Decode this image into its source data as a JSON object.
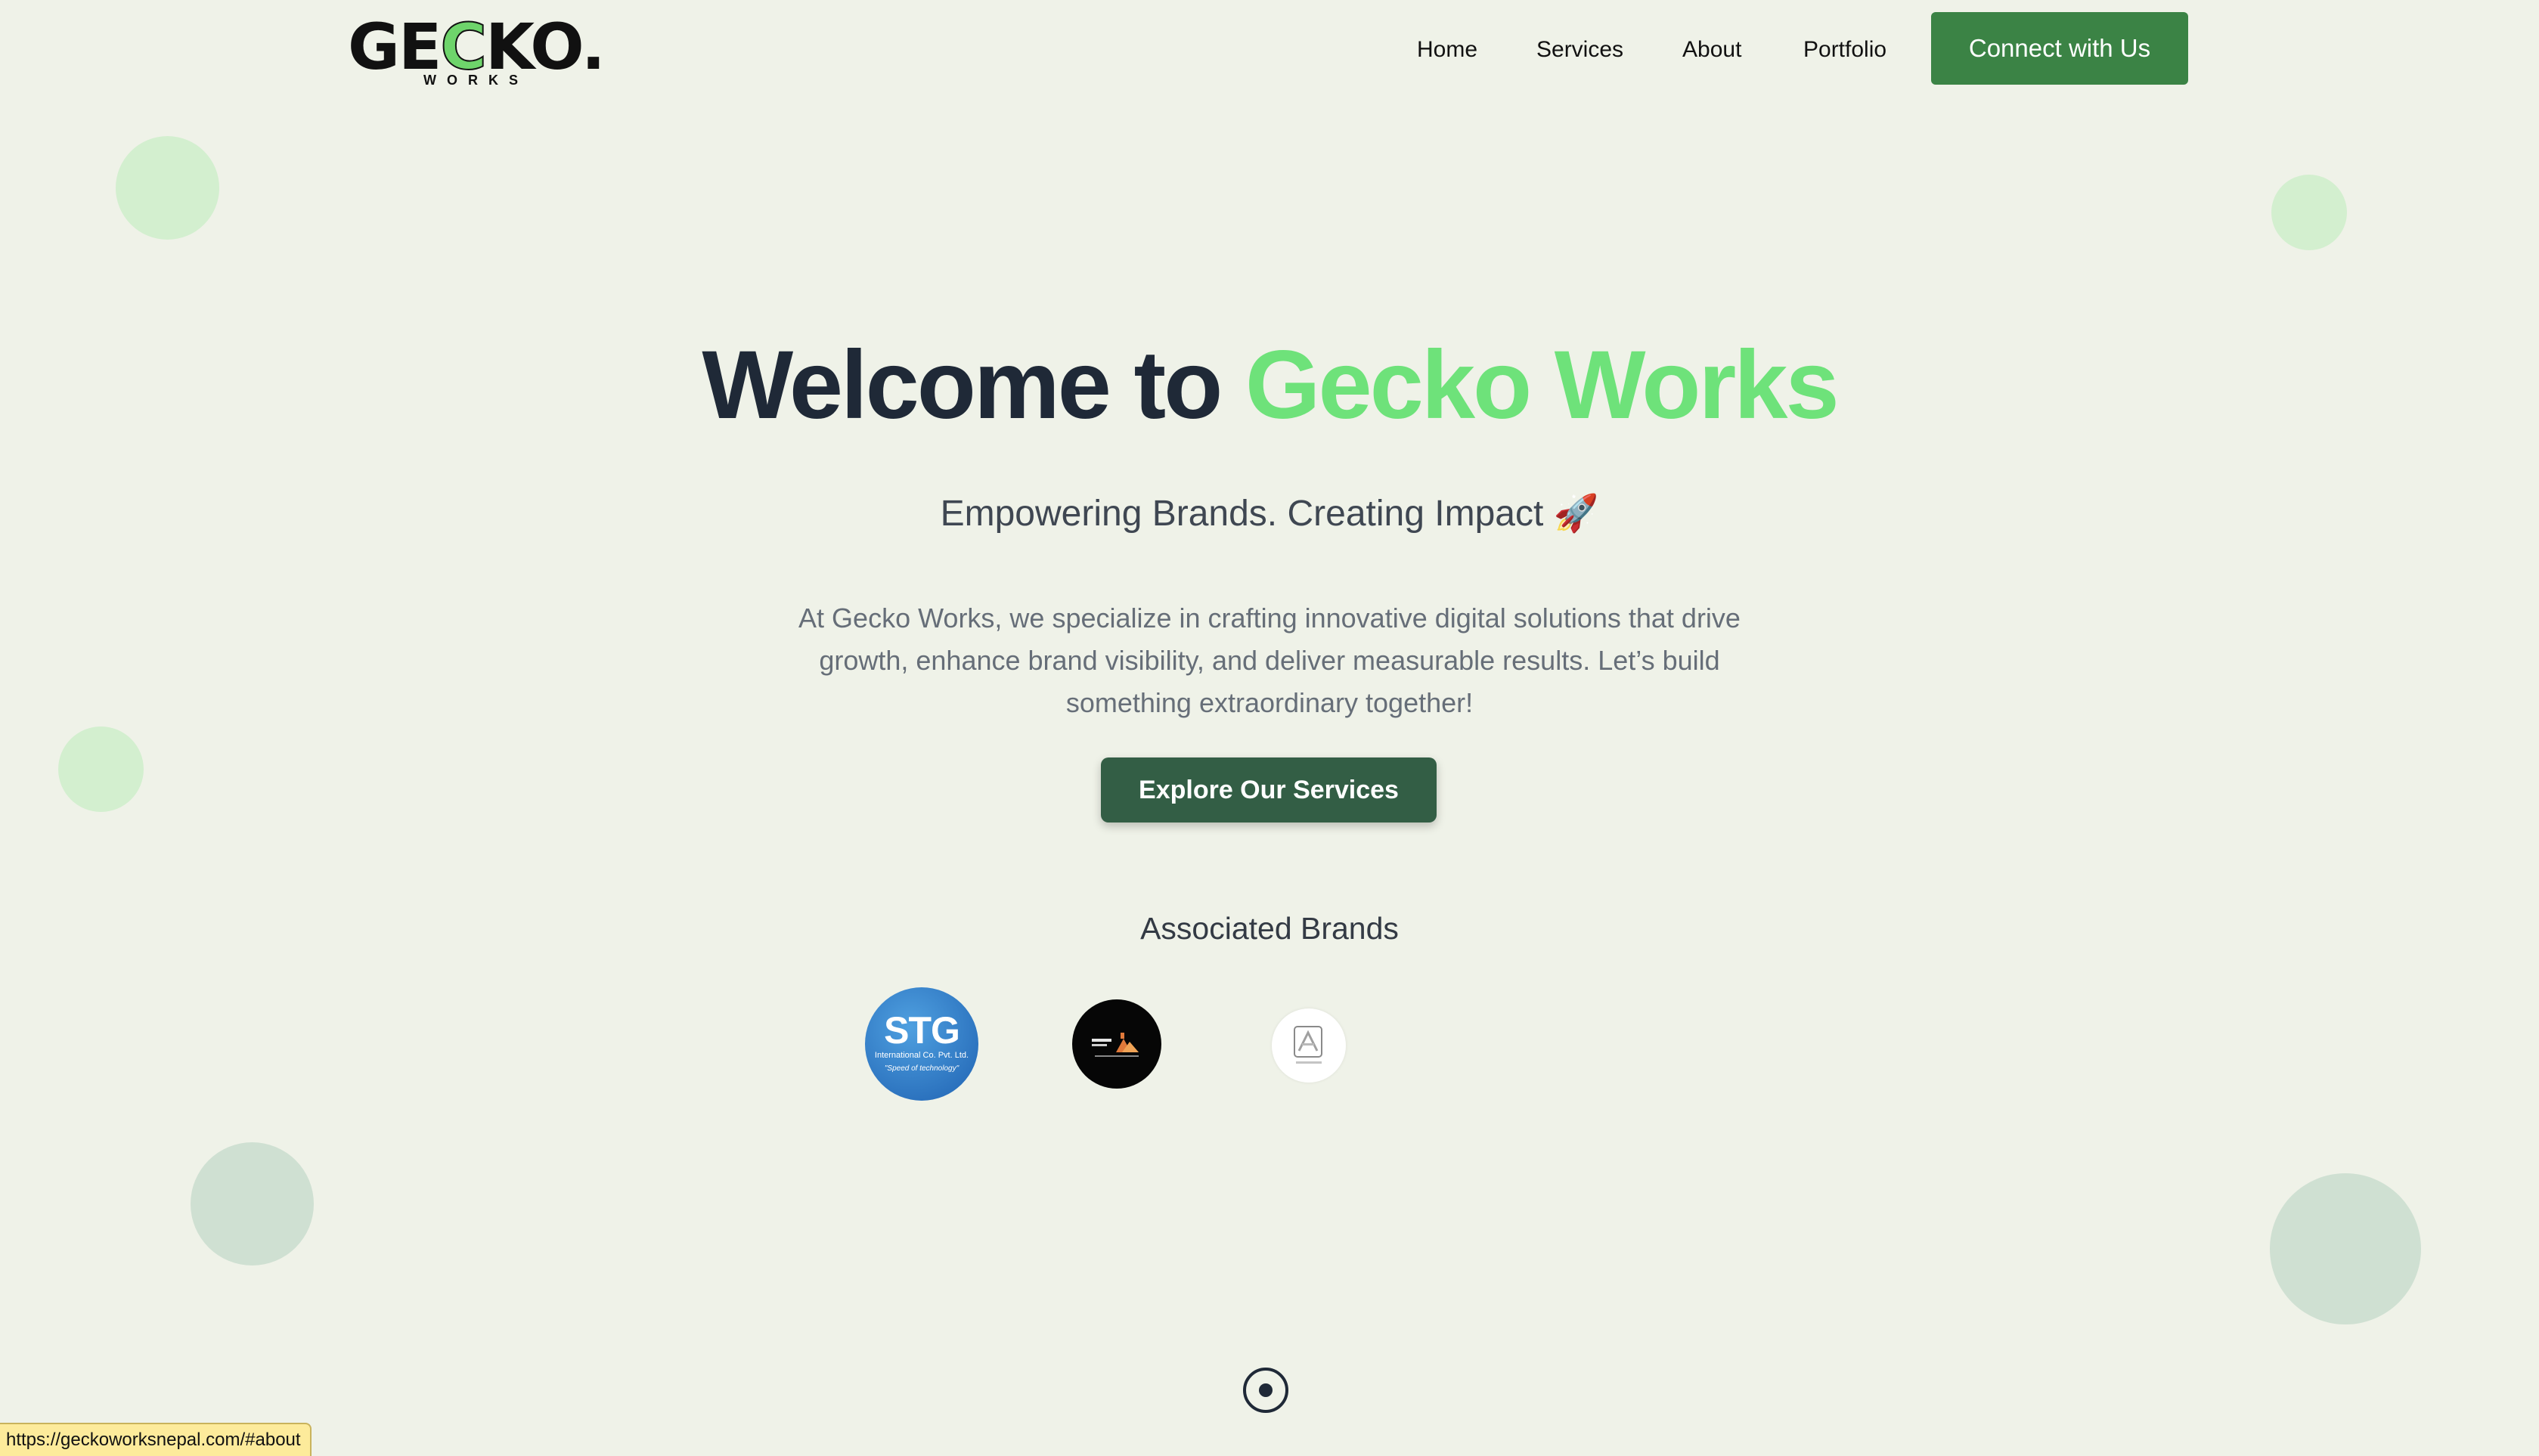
{
  "header": {
    "logo": {
      "text_start": "GE",
      "text_accent": "C",
      "text_end": "KO.",
      "subtext": "WORKS"
    },
    "nav": [
      {
        "label": "Home"
      },
      {
        "label": "Services"
      },
      {
        "label": "About"
      },
      {
        "label": "Portfolio"
      }
    ],
    "cta_label": "Connect with Us"
  },
  "hero": {
    "title_prefix": "Welcome to ",
    "title_accent": "Gecko Works",
    "tagline": "Empowering Brands. Creating Impact 🚀",
    "description": "At Gecko Works, we specialize in crafting innovative digital solutions that drive growth, enhance brand visibility, and deliver measurable results. Let’s build something extraordinary together!",
    "button_label": "Explore Our Services"
  },
  "brands": {
    "title": "Associated Brands",
    "items": [
      {
        "name": "stg",
        "big": "STG",
        "small": "International Co. Pvt. Ltd.",
        "slogan": "\"Speed of technology\""
      },
      {
        "name": "dark-brand-logo"
      },
      {
        "name": "light-brand-logo"
      }
    ]
  },
  "status_bar": {
    "url": "https://geckoworksnepal.com/#about"
  },
  "colors": {
    "background": "#eff2e8",
    "accent_green": "#6ee27a",
    "cta_green": "#3b8345",
    "button_dark_green": "#335e45"
  }
}
